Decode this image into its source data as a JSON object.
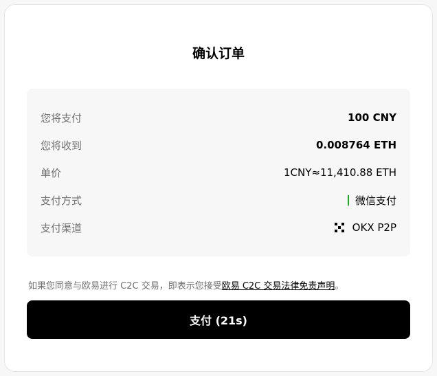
{
  "dialog": {
    "title": "确认订单"
  },
  "details": [
    {
      "label": "您将支付",
      "value": "100 CNY",
      "bold": true
    },
    {
      "label": "您将收到",
      "value": "0.008764 ETH",
      "bold": true
    },
    {
      "label": "单价",
      "value": "1CNY≈11,410.88 ETH",
      "bold": false
    },
    {
      "label": "支付方式",
      "value": "微信支付",
      "icon": "wechat-pay-indicator"
    },
    {
      "label": "支付渠道",
      "value": "OKX P2P",
      "icon": "okx-logo-icon"
    }
  ],
  "disclaimer": {
    "prefix": "如果您同意与欧易进行 C2C 交易，即表示您接受",
    "link": "欧易 C2C 交易法律免责声明",
    "suffix": "。"
  },
  "pay_button": {
    "label": "支付 (21s)"
  },
  "colors": {
    "accent": "#000000",
    "panel_bg": "#f7f7f7",
    "wechat_green": "#1aad19",
    "muted_text": "#707070"
  }
}
